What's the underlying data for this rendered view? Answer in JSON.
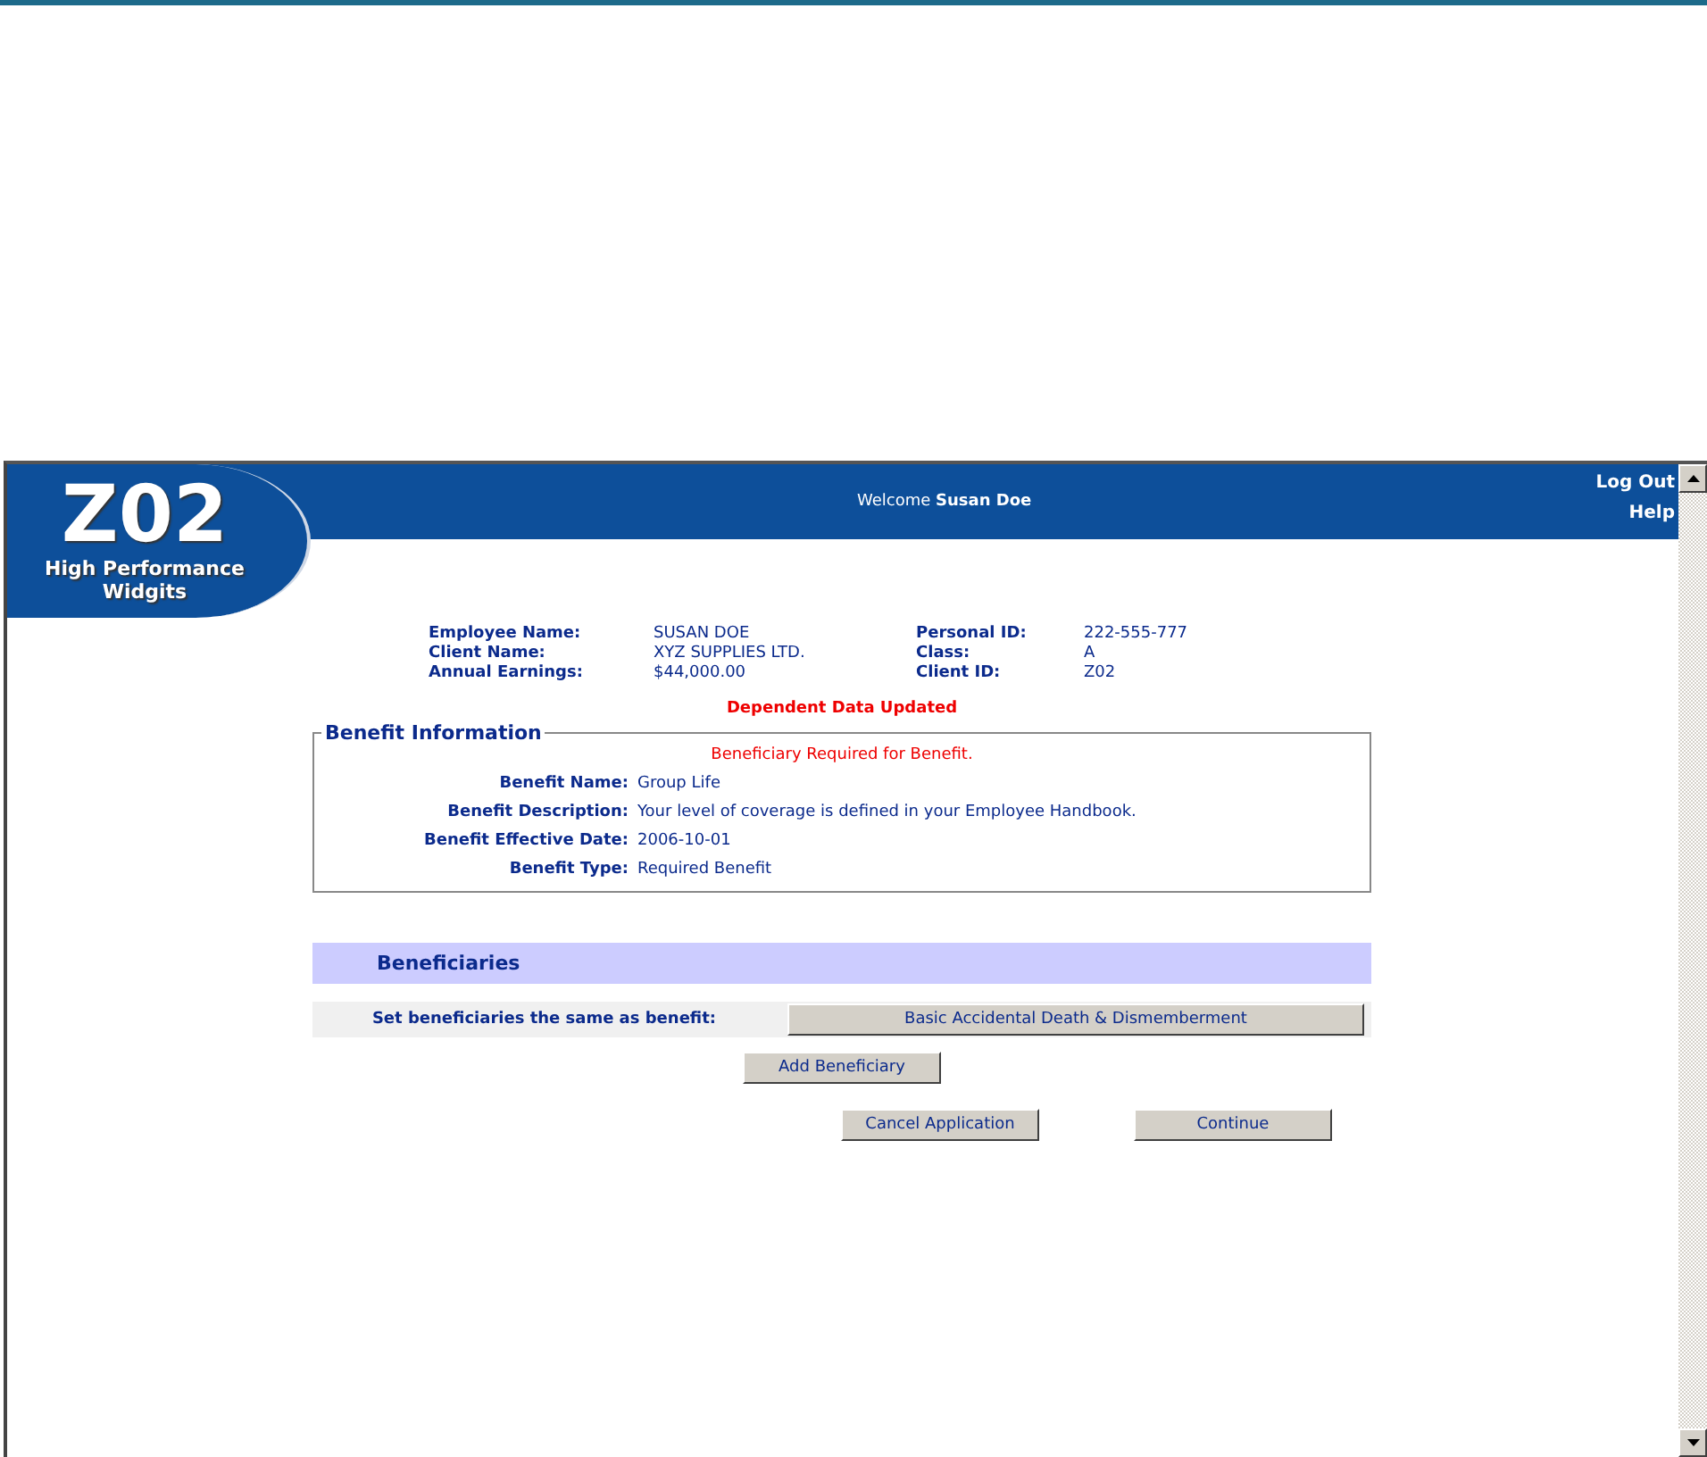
{
  "header": {
    "welcome_label": "Welcome",
    "user_name": "Susan Doe",
    "links": [
      "Log Out",
      "Help"
    ]
  },
  "logo": {
    "code": "Z02",
    "tagline_1": "High Performance",
    "tagline_2": "Widgits"
  },
  "left_fields": [
    {
      "label": "Employee Name:",
      "value": "SUSAN DOE"
    },
    {
      "label": "Client Name:",
      "value": "XYZ SUPPLIES LTD."
    },
    {
      "label": "Annual Earnings:",
      "value": "$44,000.00"
    }
  ],
  "right_fields": [
    {
      "label": "Personal ID:",
      "value": "222-555-777"
    },
    {
      "label": "Class:",
      "value": "A"
    },
    {
      "label": "Client ID:",
      "value": "Z02"
    }
  ],
  "status_message": "Dependent Data Updated",
  "benefit_information": {
    "legend": "Benefit Information",
    "warning": "Beneficiary Required for Benefit.",
    "fields": [
      {
        "label": "Benefit Name:",
        "value": "Group Life"
      },
      {
        "label": "Benefit Description:",
        "value": "Your level of coverage is defined in your Employee Handbook."
      },
      {
        "label": "Benefit Effective Date:",
        "value": "2006-10-01"
      },
      {
        "label": "Benefit Type:",
        "value": "Required Benefit"
      }
    ]
  },
  "beneficiaries": {
    "heading": "Beneficiaries",
    "same_as_label": "Set beneficiaries the same as benefit:",
    "same_as_button": "Basic Accidental Death & Dismemberment",
    "add_button": "Add Beneficiary"
  },
  "buttons": [
    "Cancel Application",
    "Continue"
  ]
}
